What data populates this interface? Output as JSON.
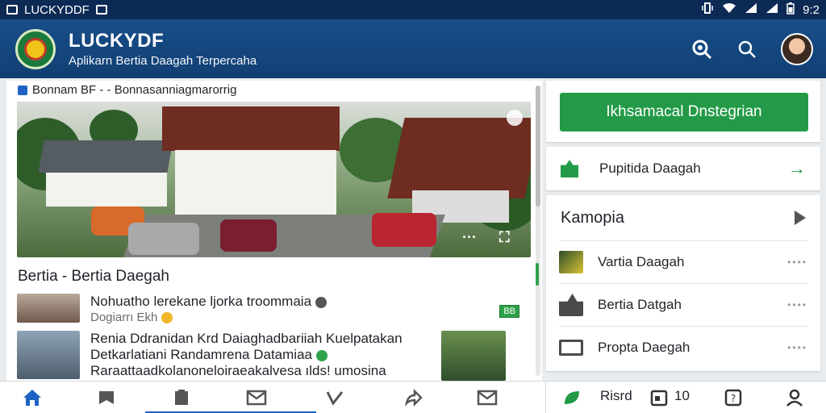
{
  "status_bar": {
    "app_name": "LUCKYDDF",
    "time": "9:2"
  },
  "header": {
    "title": "LUCKYDF",
    "tagline": "Aplikarn Bertia Daagah Terpercaha"
  },
  "main": {
    "breadcrumb": "Bonnam BF - - Bonnasanniagmarorrig",
    "section_title": "Bertia - Bertia Daegah",
    "news": [
      {
        "title": "Nohuatho lerekane ljorka troommaia",
        "subtitle": "Dogiarrı Ekh",
        "badge": "BB"
      },
      {
        "title": "Renia Ddranidan Krd Daiaghadbariiah Kuelpatakan",
        "line2": "Detkarlatiani Randamrena Datamiaa",
        "line3": "Raraattaadkolanoneloiraeakalvesa ılds! umosina"
      }
    ]
  },
  "sidebar": {
    "cta_label": "Ikhsamacal Dnstegrian",
    "link_label": "Pupitida Daagah",
    "categories_title": "Kamopia",
    "categories": [
      {
        "label": "Vartia Daagah"
      },
      {
        "label": "Bertia Datgah"
      },
      {
        "label": "Propta Daegah"
      }
    ]
  },
  "bottom_nav": {
    "right_label": "Risrd",
    "count": "10"
  },
  "colors": {
    "primary": "#174e8a",
    "accent": "#239a47",
    "status_bar": "#0d2a55"
  }
}
